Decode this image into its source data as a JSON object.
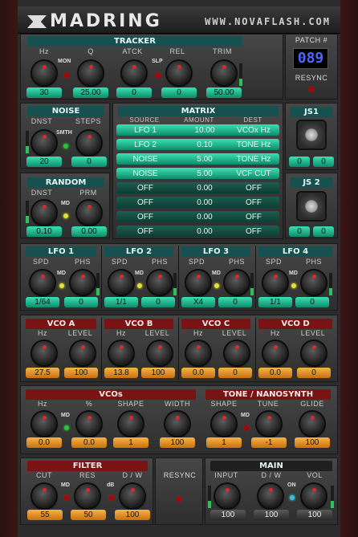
{
  "header": {
    "brand": "MADRING",
    "url": "WWW.NOVAFLASH.COM"
  },
  "tracker": {
    "title": "TRACKER",
    "labels": [
      "Hz",
      "Q",
      "ATCK",
      "REL",
      "TRIM"
    ],
    "mon": "MON",
    "slp": "SLP",
    "values": [
      "30",
      "25.00",
      "0",
      "0",
      "50.00"
    ]
  },
  "patch": {
    "label": "PATCH #",
    "number": "089",
    "resync": "RESYNC"
  },
  "noise": {
    "title": "NOISE",
    "labels": [
      "DNST",
      "STEPS"
    ],
    "smth": "SMTH",
    "values": [
      "20",
      "0"
    ]
  },
  "random": {
    "title": "RANDOM",
    "labels": [
      "DNST",
      "PRM"
    ],
    "md": "MD",
    "values": [
      "0.10",
      "0.00"
    ]
  },
  "matrix": {
    "title": "MATRIX",
    "headers": [
      "SOURCE",
      "AMOUNT",
      "DEST"
    ],
    "rows": [
      [
        "LFO 1",
        "10.00",
        "VCOx Hz"
      ],
      [
        "LFO 2",
        "0.10",
        "TONE Hz"
      ],
      [
        "NOISE",
        "5.00",
        "TONE Hz"
      ],
      [
        "NOISE",
        "5.00",
        "VCF CUT"
      ],
      [
        "OFF",
        "0.00",
        "OFF"
      ],
      [
        "OFF",
        "0.00",
        "OFF"
      ],
      [
        "OFF",
        "0.00",
        "OFF"
      ],
      [
        "OFF",
        "0.00",
        "OFF"
      ]
    ]
  },
  "js1": {
    "title": "JS1",
    "x": "0",
    "y": "0"
  },
  "js2": {
    "title": "JS 2",
    "x": "0",
    "y": "0"
  },
  "lfos": [
    {
      "title": "LFO 1",
      "spd": "1/64",
      "phs": "0"
    },
    {
      "title": "LFO 2",
      "spd": "1/1",
      "phs": "0"
    },
    {
      "title": "LFO 3",
      "spd": "X4",
      "phs": "0"
    },
    {
      "title": "LFO 4",
      "spd": "1/1",
      "phs": "0"
    }
  ],
  "lfo_labels": {
    "spd": "SPD",
    "phs": "PHS",
    "md": "MD"
  },
  "vcos": [
    {
      "title": "VCO A",
      "hz": "27.5",
      "level": "100"
    },
    {
      "title": "VCO B",
      "hz": "13.8",
      "level": "100"
    },
    {
      "title": "VCO C",
      "hz": "0.0",
      "level": "0"
    },
    {
      "title": "VCO D",
      "hz": "0.0",
      "level": "0"
    }
  ],
  "vco_labels": {
    "hz": "Hz",
    "level": "LEVEL"
  },
  "vcos_common": {
    "title": "VCOs",
    "labels": [
      "Hz",
      "%",
      "SHAPE",
      "WIDTH"
    ],
    "md": "MD",
    "values": [
      "0.0",
      "0.0",
      "1",
      "100"
    ]
  },
  "tone": {
    "title": "TONE / NANOSYNTH",
    "labels": [
      "SHAPE",
      "TUNE",
      "GLIDE"
    ],
    "md": "MD",
    "values": [
      "1",
      "-1",
      "100"
    ]
  },
  "filter": {
    "title": "FILTER",
    "labels": [
      "CUT",
      "RES",
      "D / W"
    ],
    "md": "MD",
    "db": "dB",
    "values": [
      "55",
      "50",
      "100"
    ]
  },
  "resync2": {
    "label": "RESYNC"
  },
  "main": {
    "title": "MAIN",
    "labels": [
      "INPUT",
      "D / W",
      "VOL"
    ],
    "on": "ON",
    "values": [
      "100",
      "100",
      "100"
    ]
  }
}
